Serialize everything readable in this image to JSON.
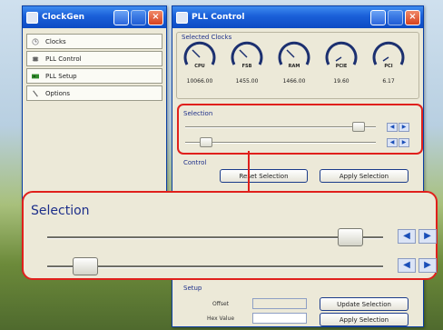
{
  "clockgen": {
    "title": "ClockGen",
    "nav": [
      {
        "label": "Clocks",
        "icon": "clock-icon"
      },
      {
        "label": "PLL Control",
        "icon": "chip-icon"
      },
      {
        "label": "PLL Setup",
        "icon": "board-icon"
      },
      {
        "label": "Options",
        "icon": "wrench-icon"
      }
    ]
  },
  "pll": {
    "title": "PLL Control",
    "selected_clocks_label": "Selected Clocks",
    "gauges": [
      {
        "name": "CPU",
        "value": "10066.00"
      },
      {
        "name": "FSB",
        "value": "1455.00"
      },
      {
        "name": "RAM",
        "value": "1466.00"
      },
      {
        "name": "PCIE",
        "value": "19.60"
      },
      {
        "name": "PCI",
        "value": "6.17"
      }
    ],
    "selection_label": "Selection",
    "control_label": "Control",
    "reset_button": "Reset Selection",
    "apply_button": "Apply Selection",
    "slider1_level": 0.93,
    "slider2_level": 0.08,
    "setup_label": "Setup",
    "offset_label": "Offset",
    "new_value_label": "Hex Value",
    "update_button": "Update Selection",
    "apply_button2": "Apply Selection"
  },
  "zoom": {
    "selection_label": "Selection"
  },
  "colors": {
    "titlebar": "#1a5fd8",
    "highlight": "#e0201c",
    "window": "#ece9d8"
  }
}
